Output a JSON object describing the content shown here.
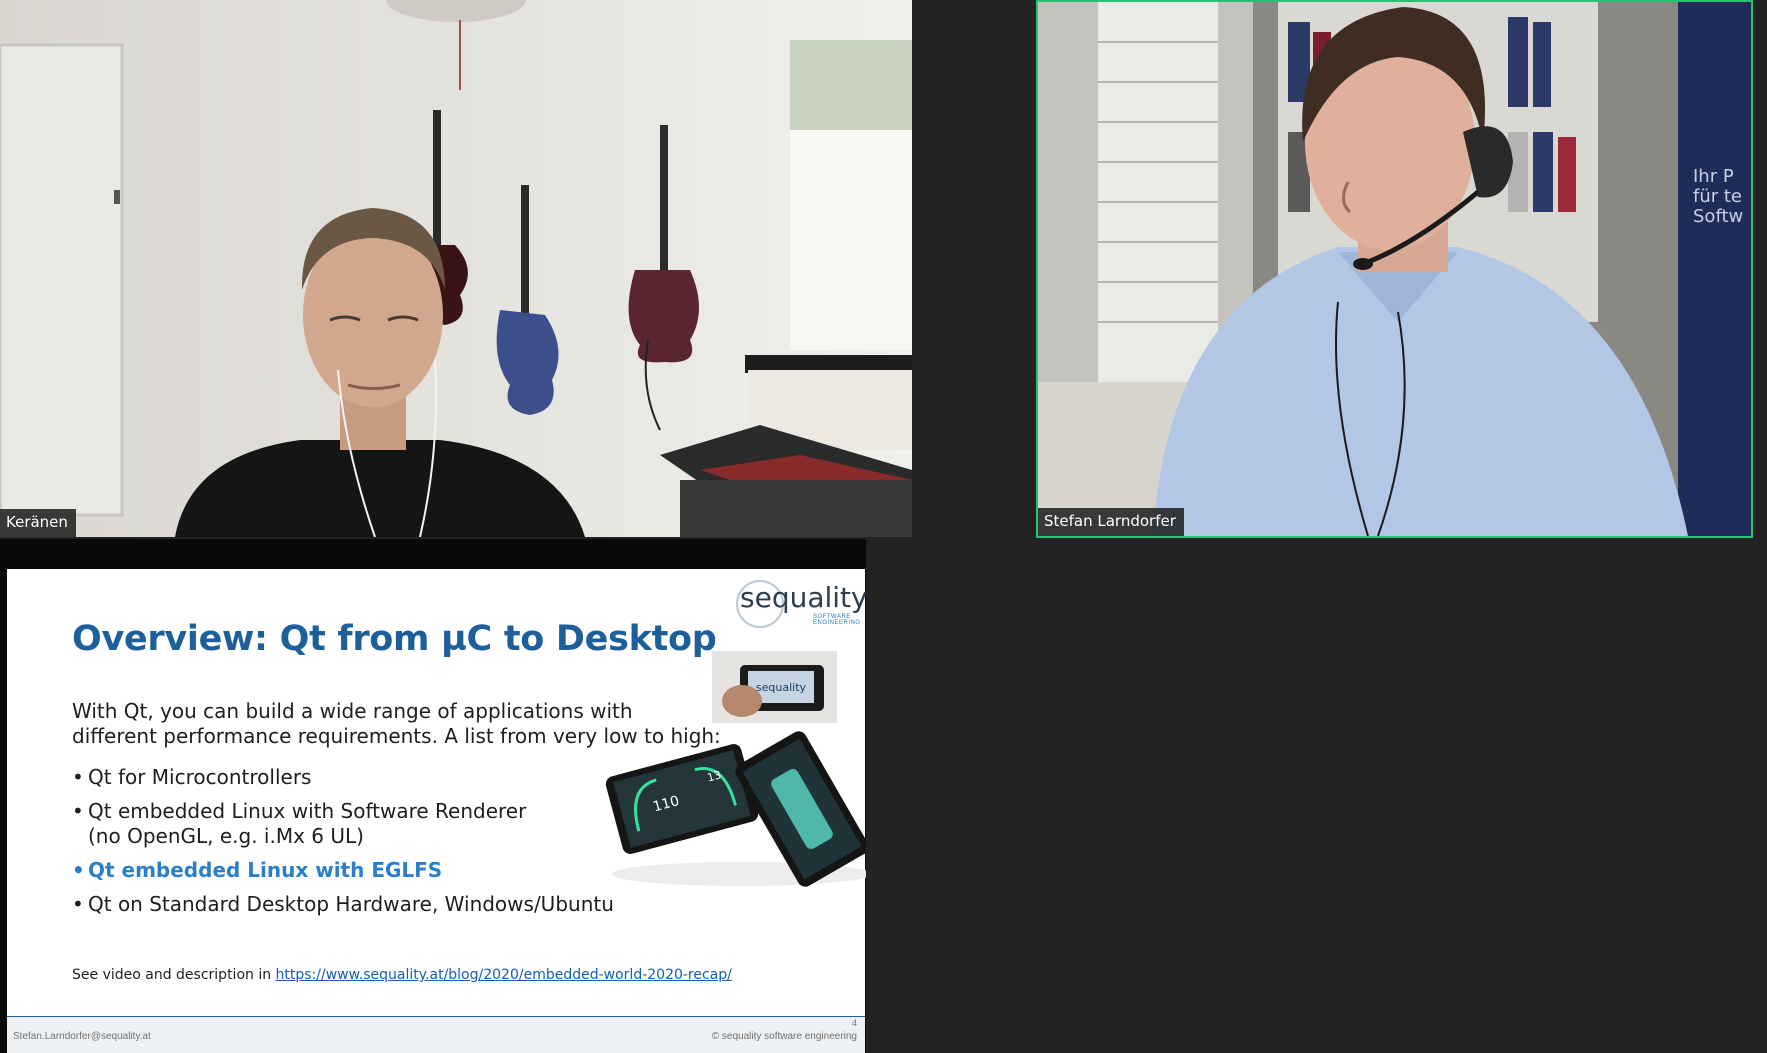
{
  "participants": [
    {
      "name": "Keränen"
    },
    {
      "name": "Stefan Larndorfer",
      "active_speaker": true
    }
  ],
  "colors": {
    "active_speaker_border": "#2bbf72",
    "meeting_background": "#232323",
    "slide_title": "#1c5f9a",
    "slide_highlight": "#2a7fc9",
    "link": "#1a5bb5"
  },
  "shared_screen": {
    "logo": {
      "brand": "sequality",
      "sub_line_1": "SOFTWARE",
      "sub_line_2": "ENGINEERING"
    },
    "title": "Overview: Qt from µC to Desktop",
    "intro_line_1": "With Qt, you can build a wide range of applications with",
    "intro_line_2": "different performance requirements. A list from very low to high:",
    "bullets": [
      {
        "text": "Qt for Microcontrollers"
      },
      {
        "text": "Qt embedded Linux with Software Renderer",
        "sub": "(no OpenGL, e.g. i.Mx 6 UL)"
      },
      {
        "text": "Qt embedded Linux with EGLFS",
        "highlighted": true
      },
      {
        "text": "Qt on Standard Desktop Hardware, Windows/Ubuntu"
      }
    ],
    "see_prefix": "See video and description in ",
    "link": "https://www.sequality.at/blog/2020/embedded-world-2020-recap/",
    "dash_speed": "110",
    "dash_value": "13",
    "device_logo": "sequality",
    "footer_left": "Stefan.Larndorfer@sequality.at",
    "footer_right": "© sequality software engineering",
    "page_number": "4"
  }
}
